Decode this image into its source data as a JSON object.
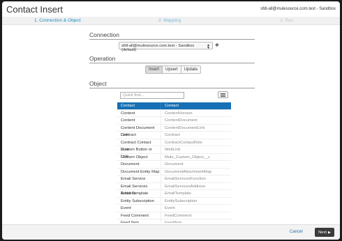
{
  "dialog": {
    "title": "Contact Insert",
    "account": "sfdl-all@mulesource.com.test - Sandbox"
  },
  "steps": [
    {
      "label": "1. Connection & Object",
      "state": "active"
    },
    {
      "label": "2. Mapping",
      "state": "next"
    },
    {
      "label": "3. Run",
      "state": "disabled"
    }
  ],
  "connection": {
    "heading": "Connection",
    "selected": "sfdl-all@mulesource.com.test - Sandbox (default)",
    "add_icon": "plus-icon"
  },
  "operation": {
    "heading": "Operation",
    "options": [
      "Insert",
      "Upsert",
      "Update"
    ],
    "selected": "Insert"
  },
  "object": {
    "heading": "Object",
    "quickfind_placeholder": "Quick find...",
    "list_icon": "list-icon",
    "rows": [
      {
        "label": "Contact",
        "api": "Contact",
        "selected": true
      },
      {
        "label": "Content",
        "api": "ContentVersion"
      },
      {
        "label": "Content",
        "api": "ContentDocument"
      },
      {
        "label": "Content Document Link",
        "api": "ContentDocumentLink"
      },
      {
        "label": "Contract",
        "api": "Contract"
      },
      {
        "label": "Contract Contact Role",
        "api": "ContractContactRole"
      },
      {
        "label": "Custom Button or Link",
        "api": "WebLink"
      },
      {
        "label": "Custom Object",
        "api": "Mule_Custom_Object__c"
      },
      {
        "label": "Document",
        "api": "Document"
      },
      {
        "label": "Document Entity Map",
        "api": "DocumentAttachmentMap"
      },
      {
        "label": "Email Service",
        "api": "EmailServicesFunction"
      },
      {
        "label": "Email Services Address",
        "api": "EmailServicesAddress"
      },
      {
        "label": "Email Template",
        "api": "EmailTemplate"
      },
      {
        "label": "Entity Subscription",
        "api": "EntitySubscription"
      },
      {
        "label": "Event",
        "api": "Event"
      },
      {
        "label": "Feed Comment",
        "api": "FeedComment"
      },
      {
        "label": "Feed Item",
        "api": "FeedItem"
      }
    ]
  },
  "footer": {
    "cancel_label": "Cancel",
    "next_label": "Next"
  },
  "colors": {
    "accent": "#1e8fc6",
    "selected_row": "#1670b5",
    "next_button": "#3b3b3b"
  }
}
